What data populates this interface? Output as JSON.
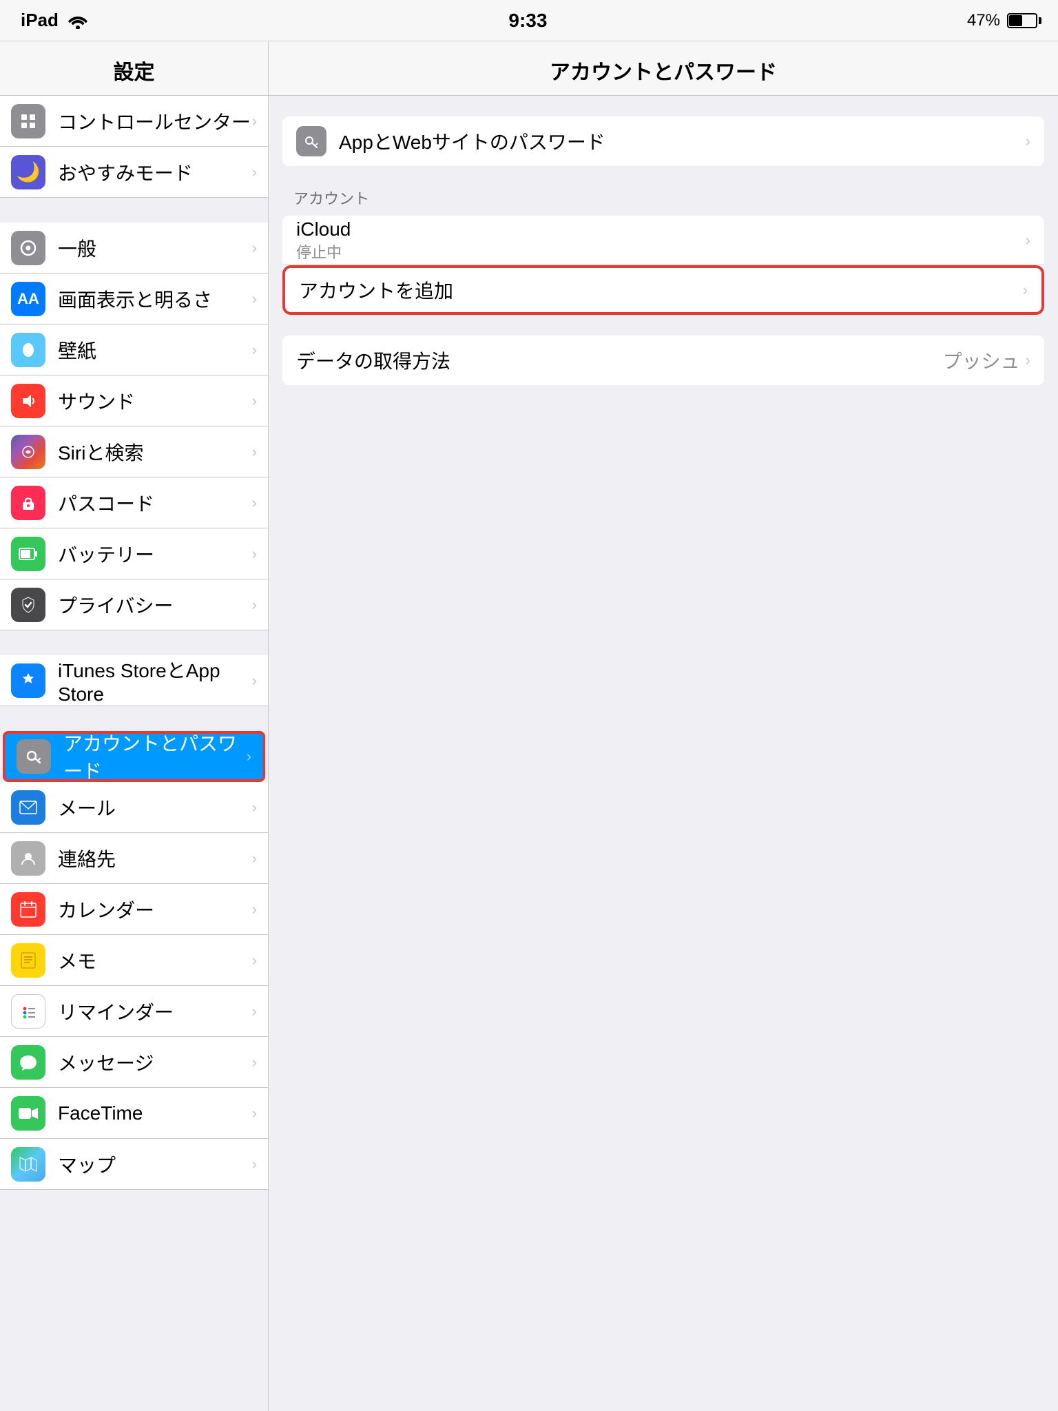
{
  "statusBar": {
    "device": "iPad",
    "time": "9:33",
    "battery": "47%",
    "wifiIcon": "wifi"
  },
  "sidebar": {
    "title": "設定",
    "items": [
      {
        "id": "control-center",
        "label": "コントロールセンター",
        "icon": "⊞",
        "iconClass": "icon-gray",
        "selected": false
      },
      {
        "id": "do-not-disturb",
        "label": "おやすみモード",
        "icon": "🌙",
        "iconClass": "icon-purple",
        "selected": false
      },
      {
        "id": "general",
        "label": "一般",
        "icon": "⚙",
        "iconClass": "icon-gray",
        "selected": false
      },
      {
        "id": "display",
        "label": "画面表示と明るさ",
        "icon": "AA",
        "iconClass": "icon-blue",
        "selected": false
      },
      {
        "id": "wallpaper",
        "label": "壁紙",
        "icon": "✿",
        "iconClass": "icon-teal",
        "selected": false
      },
      {
        "id": "sounds",
        "label": "サウンド",
        "icon": "🔔",
        "iconClass": "icon-red",
        "selected": false
      },
      {
        "id": "siri",
        "label": "Siriと検索",
        "icon": "◎",
        "iconClass": "icon-darkgray2",
        "selected": false
      },
      {
        "id": "passcode",
        "label": "パスコード",
        "icon": "🔒",
        "iconClass": "icon-pink",
        "selected": false
      },
      {
        "id": "battery",
        "label": "バッテリー",
        "icon": "▬",
        "iconClass": "icon-green",
        "selected": false
      },
      {
        "id": "privacy",
        "label": "プライバシー",
        "icon": "✋",
        "iconClass": "icon-darkgray2",
        "selected": false
      },
      {
        "id": "itunes-appstore",
        "label": "iTunes StoreとApp Store",
        "icon": "A",
        "iconClass": "icon-appstore",
        "selected": false
      },
      {
        "id": "accounts-passwords",
        "label": "アカウントとパスワード",
        "icon": "🔑",
        "iconClass": "icon-key",
        "selected": true
      },
      {
        "id": "mail",
        "label": "メール",
        "icon": "✉",
        "iconClass": "icon-mail",
        "selected": false
      },
      {
        "id": "contacts",
        "label": "連絡先",
        "icon": "👤",
        "iconClass": "icon-contacts",
        "selected": false
      },
      {
        "id": "calendar",
        "label": "カレンダー",
        "icon": "📅",
        "iconClass": "icon-calendar",
        "selected": false
      },
      {
        "id": "notes",
        "label": "メモ",
        "icon": "📝",
        "iconClass": "icon-notes",
        "selected": false
      },
      {
        "id": "reminders",
        "label": "リマインダー",
        "icon": "≡",
        "iconClass": "icon-reminders",
        "selected": false
      },
      {
        "id": "messages",
        "label": "メッセージ",
        "icon": "💬",
        "iconClass": "icon-messages",
        "selected": false
      },
      {
        "id": "facetime",
        "label": "FaceTime",
        "icon": "📹",
        "iconClass": "icon-facetime",
        "selected": false
      },
      {
        "id": "maps",
        "label": "マップ",
        "icon": "🗺",
        "iconClass": "icon-maps",
        "selected": false
      }
    ]
  },
  "rightPanel": {
    "title": "アカウントとパスワード",
    "passwordRow": {
      "label": "AppとWebサイトのパスワード",
      "iconColor": "#8e8e93"
    },
    "accountsSection": {
      "label": "アカウント",
      "icloud": {
        "title": "iCloud",
        "subtitle": "停止中"
      },
      "addAccount": {
        "title": "アカウントを追加"
      }
    },
    "dataFetchSection": {
      "title": "データの取得方法",
      "value": "プッシュ"
    }
  }
}
